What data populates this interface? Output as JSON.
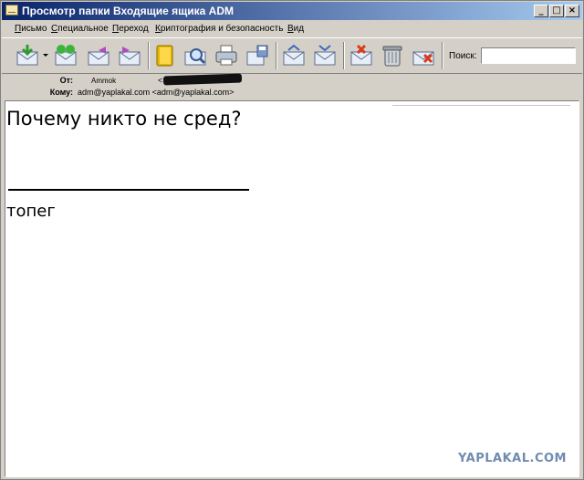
{
  "window": {
    "title": "Просмотр папки Входящие ящика ADM",
    "controls": {
      "minimize": "_",
      "maximize": "□",
      "close": "×"
    }
  },
  "menu": [
    {
      "underline": "П",
      "rest": "исьмо"
    },
    {
      "underline": "С",
      "rest": "пециальное"
    },
    {
      "underline": "П",
      "rest": "ереход"
    },
    {
      "underline": "К",
      "rest": "риптография и безопасность"
    },
    {
      "underline": "В",
      "rest": "ид"
    }
  ],
  "toolbar": {
    "buttons": [
      "get-mail",
      "write",
      "reply",
      "forward",
      "address-book",
      "find",
      "print",
      "save",
      "previous",
      "next",
      "junk",
      "delete",
      "delete-move"
    ],
    "search_label": "Поиск:",
    "search_value": ""
  },
  "headers": {
    "from_label": "От:",
    "from_name": "Ammok",
    "from_addr_prefix": "<",
    "to_label": "Кому:",
    "to_value": "adm@yaplakal.com <adm@yaplakal.com>"
  },
  "message": {
    "heading": "Почему никто не сред?",
    "body": "топег"
  },
  "watermark": "YAPLAKAL.COM",
  "colors": {
    "titlebar_start": "#0a246a",
    "titlebar_end": "#a6caf0",
    "chrome": "#d4d0c8",
    "watermark": "#6f8bb0"
  }
}
